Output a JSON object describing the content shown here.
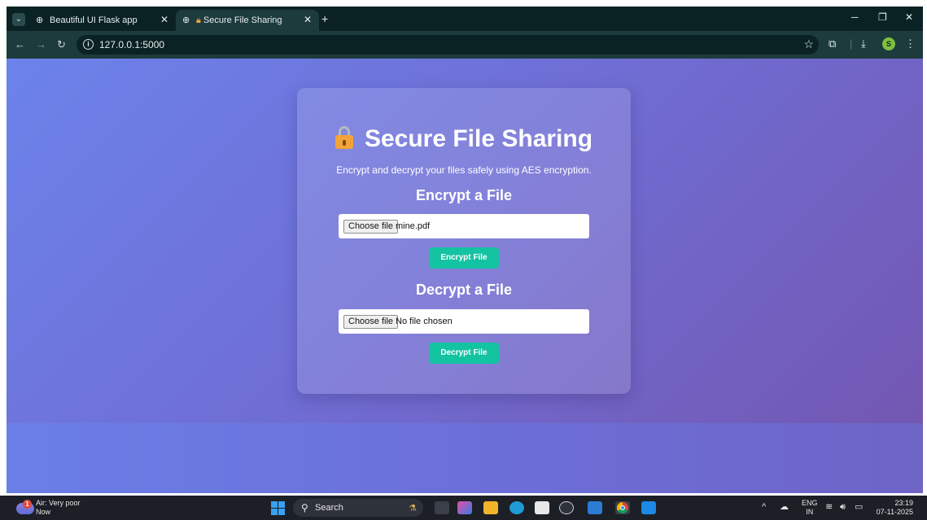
{
  "browser": {
    "tabs": [
      {
        "title": "Beautiful UI Flask app",
        "active": false
      },
      {
        "title": "Secure File Sharing",
        "active": true
      }
    ],
    "url": "127.0.0.1:5000",
    "profile_initial": "S"
  },
  "page": {
    "title": "Secure File Sharing",
    "subtitle": "Encrypt and decrypt your files safely using AES encryption.",
    "encrypt": {
      "heading": "Encrypt a File",
      "choose_label": "Choose file",
      "file_value": "mine.pdf",
      "button_label": "Encrypt File"
    },
    "decrypt": {
      "heading": "Decrypt a File",
      "choose_label": "Choose file",
      "file_value": "No file chosen",
      "button_label": "Decrypt File"
    },
    "colors": {
      "accent_button": "#14c3a2",
      "gradient_start": "#6b83ea",
      "gradient_end": "#7357b2"
    }
  },
  "taskbar": {
    "weather_badge": "1",
    "weather_line1": "Air: Very poor",
    "weather_line2": "Now",
    "search_label": "Search",
    "lang_line1": "ENG",
    "lang_line2": "IN",
    "time": "23:19",
    "date": "07-11-2025"
  }
}
